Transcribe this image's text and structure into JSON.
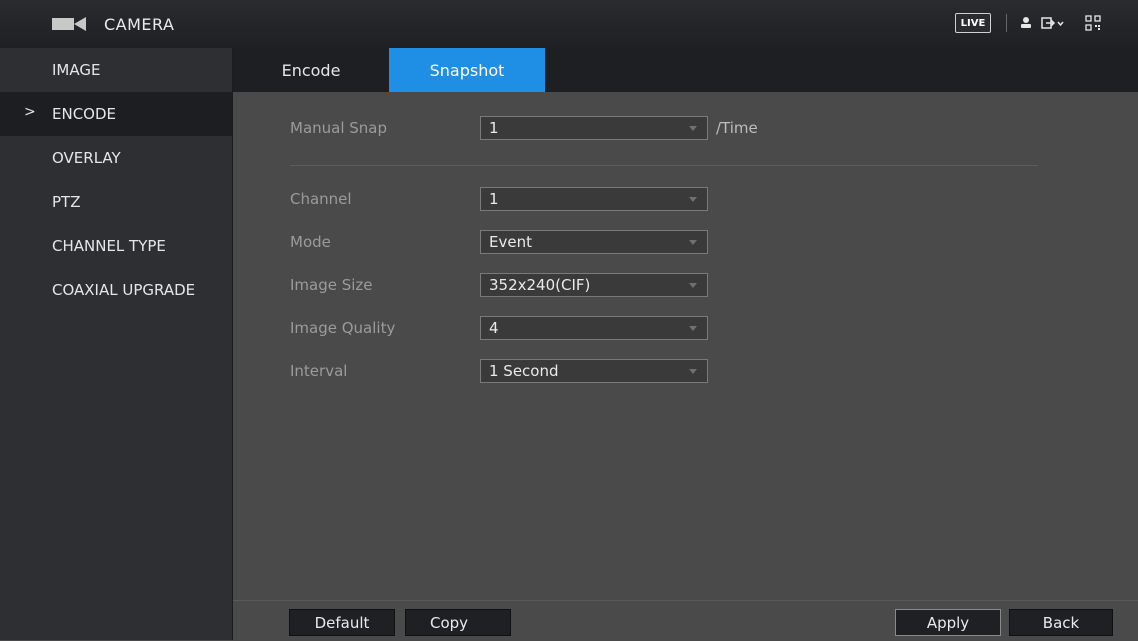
{
  "header": {
    "title": "CAMERA",
    "live_label": "LIVE",
    "icons": [
      "camera-icon",
      "user-icon",
      "logout-icon",
      "qr-code-icon"
    ]
  },
  "sidebar": {
    "items": [
      {
        "label": "IMAGE",
        "active": false
      },
      {
        "label": "ENCODE",
        "active": true
      },
      {
        "label": "OVERLAY",
        "active": false
      },
      {
        "label": "PTZ",
        "active": false
      },
      {
        "label": "CHANNEL TYPE",
        "active": false
      },
      {
        "label": "COAXIAL UPGRADE",
        "active": false
      }
    ],
    "active_marker": ">"
  },
  "tabs": [
    {
      "label": "Encode",
      "active": false
    },
    {
      "label": "Snapshot",
      "active": true
    }
  ],
  "form": {
    "manual_snap": {
      "label": "Manual Snap",
      "value": "1",
      "unit": "/Time"
    },
    "channel": {
      "label": "Channel",
      "value": "1"
    },
    "mode": {
      "label": "Mode",
      "value": "Event"
    },
    "image_size": {
      "label": "Image Size",
      "value": "352x240(CIF)"
    },
    "image_quality": {
      "label": "Image Quality",
      "value": "4"
    },
    "interval": {
      "label": "Interval",
      "value": "1 Second"
    }
  },
  "buttons": {
    "default": "Default",
    "copy": "Copy",
    "apply": "Apply",
    "back": "Back"
  },
  "colors": {
    "accent": "#1f8fe6",
    "sidebar_bg": "#2e2f33",
    "content_bg": "#4a4a4a"
  }
}
